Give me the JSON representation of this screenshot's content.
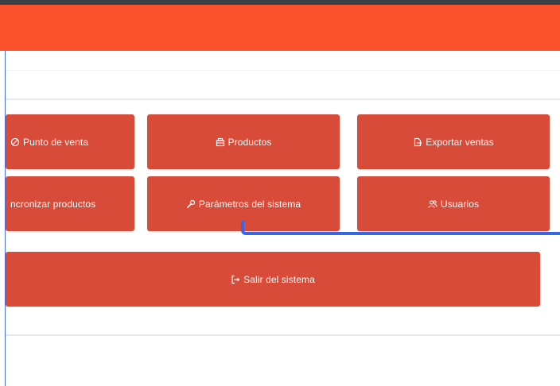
{
  "menu": {
    "items": [
      {
        "label": "Punto de venta",
        "icon": "ban-icon"
      },
      {
        "label": "Productos",
        "icon": "box-icon"
      },
      {
        "label": "Exportar ventas",
        "icon": "file-export-icon"
      },
      {
        "label": "ncronizar productos",
        "icon": ""
      },
      {
        "label": "Parámetros del sistema",
        "icon": "wrench-icon"
      },
      {
        "label": "Usuarios",
        "icon": "users-icon"
      }
    ],
    "exit": {
      "label": "Salir del sistema",
      "icon": "sign-out-icon"
    }
  },
  "colors": {
    "header": "#fb512c",
    "tile": "#d84b38",
    "annotation": "#3867e6"
  }
}
